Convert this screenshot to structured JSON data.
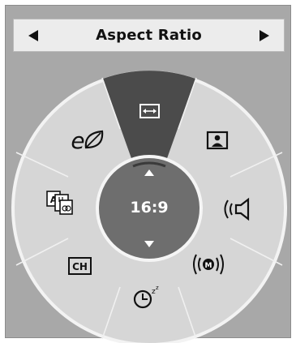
{
  "header": {
    "title": "Aspect Ratio",
    "prev_icon": "triangle-left-icon",
    "next_icon": "triangle-right-icon"
  },
  "dial": {
    "center_value": "16:9",
    "selected_item": "aspect-ratio",
    "items": [
      {
        "id": "aspect-ratio",
        "icon": "horizontal-arrows-icon"
      },
      {
        "id": "picture-mode",
        "icon": "picture-person-icon"
      },
      {
        "id": "sound-mode",
        "icon": "speaker-icon"
      },
      {
        "id": "sound-zoom",
        "icon": "radio-waves-m-icon"
      },
      {
        "id": "sleep-timer",
        "icon": "clock-zzz-icon"
      },
      {
        "id": "channel",
        "icon": "ch-box-icon",
        "label": "CH"
      },
      {
        "id": "caption-language",
        "icon": "language-caption-icon",
        "label": "A"
      },
      {
        "id": "energy-saving",
        "icon": "eco-leaf-icon",
        "label": "e"
      }
    ]
  },
  "colors": {
    "background": "#a8a8a8",
    "header_bg": "#ececec",
    "ring": "#d6d6d6",
    "selected": "#4b4b4b",
    "center": "#6e6e6e",
    "text_dark": "#111111",
    "text_light": "#ffffff"
  }
}
